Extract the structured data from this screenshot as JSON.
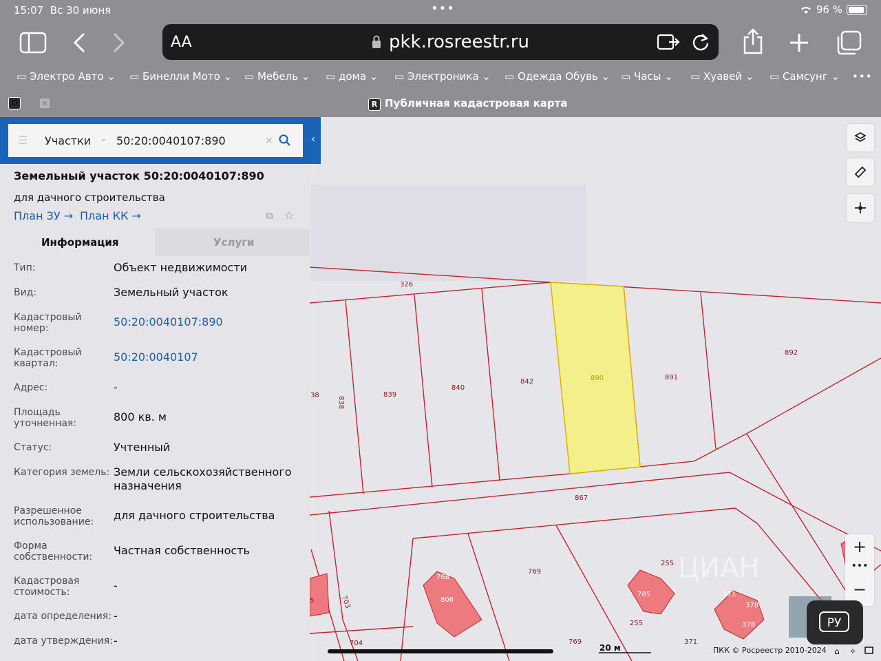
{
  "status_bar": {
    "time": "15:07",
    "date": "Вс 30 июня",
    "dots": "•••",
    "battery": "96 %"
  },
  "browser": {
    "text_size": "AA",
    "url": "pkk.rosreestr.ru"
  },
  "bookmarks": [
    "Электро Авто",
    "Бинелли Мото",
    "Мебель",
    "дома",
    "Электроника",
    "Одежда Обувь",
    "Часы",
    "Хуавей",
    "Самсунг"
  ],
  "tab": {
    "title": "Публичная кадастровая карта",
    "badge": "R",
    "left_badge": "D"
  },
  "search": {
    "category": "Участки",
    "query": "50:20:0040107:890"
  },
  "object": {
    "title": "Земельный участок 50:20:0040107:890",
    "subtitle": "для дачного строительства",
    "link_plan_zu": "План ЗУ",
    "link_plan_kk": "План КК"
  },
  "tabs": {
    "info": "Информация",
    "services": "Услуги"
  },
  "fields": [
    {
      "label": "Тип:",
      "value": "Объект недвижимости"
    },
    {
      "label": "Вид:",
      "value": "Земельный участок"
    },
    {
      "label": "Кадастровый номер:",
      "value": "50:20:0040107:890"
    },
    {
      "label": "Кадастровый квартал:",
      "value": "50:20:0040107"
    },
    {
      "label": "Адрес:",
      "value": "-"
    },
    {
      "label": "Площадь уточненная:",
      "value": "800 кв. м"
    },
    {
      "label": "Статус:",
      "value": "Учтенный"
    },
    {
      "label": "Категория земель:",
      "value": "Земли сельскохозяйственного назначения"
    },
    {
      "label": "Разрешенное использование:",
      "value": "для дачного строительства"
    },
    {
      "label": "Форма собственности:",
      "value": "Частная собственность"
    },
    {
      "label": "Кадастровая стоимость:",
      "value": "-"
    },
    {
      "label": "дата определения:",
      "value": "-"
    },
    {
      "label": "дата утверждения:",
      "value": "-"
    }
  ],
  "map": {
    "parcel_labels": [
      "326",
      "38",
      "838",
      "839",
      "840",
      "842",
      "890",
      "891",
      "892",
      "867",
      "768",
      "806",
      "769",
      "255",
      "785",
      "371",
      "378",
      "703",
      "704",
      "5"
    ],
    "scale": "20 м",
    "copyright": "ПКК © Росреестр 2010-2024",
    "lang_button": "РУ",
    "watermark": "ЦИАН",
    "highlight_color": "#f3ef8a",
    "boundary_color": "#c1272d"
  }
}
